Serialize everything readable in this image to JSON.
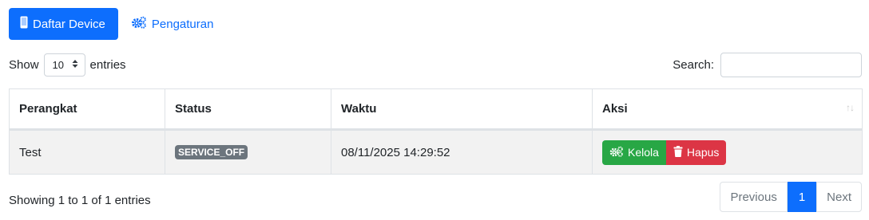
{
  "tabs": {
    "device_label": "Daftar Device",
    "settings_label": "Pengaturan"
  },
  "length_menu": {
    "show_label": "Show",
    "selected": "10",
    "entries_label": "entries"
  },
  "search": {
    "label": "Search:",
    "value": ""
  },
  "table": {
    "headers": [
      "Perangkat",
      "Status",
      "Waktu",
      "Aksi"
    ],
    "rows": [
      {
        "device": "Test",
        "status": "SERVICE_OFF",
        "time": "08/11/2025 14:29:52",
        "actions": {
          "manage": "Kelola",
          "delete": "Hapus"
        }
      }
    ]
  },
  "info": "Showing 1 to 1 of 1 entries",
  "pagination": {
    "previous": "Previous",
    "current": "1",
    "next": "Next"
  },
  "colors": {
    "primary": "#0d6efd",
    "success": "#28a745",
    "danger": "#dc3545",
    "badge": "#6c757d"
  },
  "icons": {
    "device_tab": "mobile-icon",
    "settings_tab": "gears-icon",
    "manage": "gears-icon",
    "delete": "trash-icon",
    "sort": "sort-icon"
  }
}
